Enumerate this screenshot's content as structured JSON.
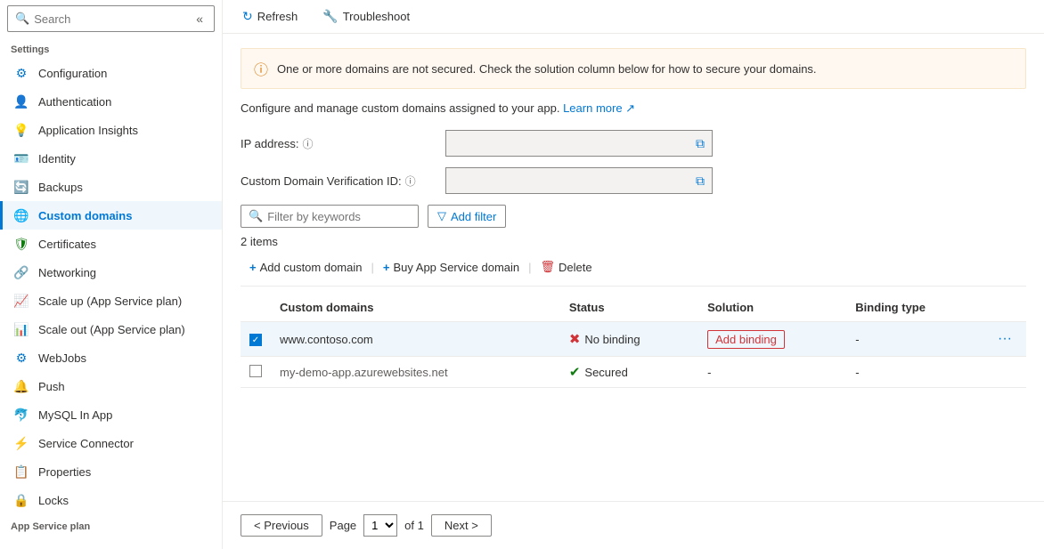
{
  "sidebar": {
    "search_placeholder": "Search",
    "collapse_icon": "«",
    "sections": [
      {
        "label": "Settings",
        "items": [
          {
            "id": "configuration",
            "label": "Configuration",
            "icon": "⚙",
            "icon_color": "#0078d4",
            "active": false
          },
          {
            "id": "authentication",
            "label": "Authentication",
            "icon": "👤",
            "icon_color": "#6264a7",
            "active": false
          },
          {
            "id": "application-insights",
            "label": "Application Insights",
            "icon": "💡",
            "icon_color": "#8b5cf6",
            "active": false
          },
          {
            "id": "identity",
            "label": "Identity",
            "icon": "🪪",
            "icon_color": "#f59e0b",
            "active": false
          },
          {
            "id": "backups",
            "label": "Backups",
            "icon": "🔄",
            "icon_color": "#0078d4",
            "active": false
          },
          {
            "id": "custom-domains",
            "label": "Custom domains",
            "icon": "🌐",
            "icon_color": "#0078d4",
            "active": true
          },
          {
            "id": "certificates",
            "label": "Certificates",
            "icon": "🛡",
            "icon_color": "#107c10",
            "active": false
          },
          {
            "id": "networking",
            "label": "Networking",
            "icon": "🔗",
            "icon_color": "#0078d4",
            "active": false
          },
          {
            "id": "scale-up",
            "label": "Scale up (App Service plan)",
            "icon": "📈",
            "icon_color": "#0078d4",
            "active": false
          },
          {
            "id": "scale-out",
            "label": "Scale out (App Service plan)",
            "icon": "📊",
            "icon_color": "#0078d4",
            "active": false
          },
          {
            "id": "webjobs",
            "label": "WebJobs",
            "icon": "⚙",
            "icon_color": "#0078d4",
            "active": false
          },
          {
            "id": "push",
            "label": "Push",
            "icon": "🔔",
            "icon_color": "#0078d4",
            "active": false
          },
          {
            "id": "mysql-in-app",
            "label": "MySQL In App",
            "icon": "🐬",
            "icon_color": "#0078d4",
            "active": false
          },
          {
            "id": "service-connector",
            "label": "Service Connector",
            "icon": "⚡",
            "icon_color": "#0078d4",
            "active": false
          },
          {
            "id": "properties",
            "label": "Properties",
            "icon": "📋",
            "icon_color": "#0078d4",
            "active": false
          },
          {
            "id": "locks",
            "label": "Locks",
            "icon": "🔒",
            "icon_color": "#605e5c",
            "active": false
          }
        ]
      }
    ],
    "bottom_section_label": "App Service plan"
  },
  "toolbar": {
    "refresh_label": "Refresh",
    "troubleshoot_label": "Troubleshoot",
    "refresh_icon": "↻",
    "troubleshoot_icon": "🔧"
  },
  "main": {
    "warning_text": "One or more domains are not secured. Check the solution column below for how to secure your domains.",
    "description": "Configure and manage custom domains assigned to your app.",
    "learn_more_label": "Learn more",
    "ip_address_label": "IP address:",
    "custom_domain_id_label": "Custom Domain Verification ID:",
    "info_icon": "ⓘ",
    "filter_placeholder": "Filter by keywords",
    "add_filter_label": "Add filter",
    "items_count": "2 items",
    "actions": {
      "add_custom_domain": "Add custom domain",
      "buy_app_service_domain": "Buy App Service domain",
      "delete": "Delete"
    },
    "table": {
      "columns": [
        "Custom domains",
        "Status",
        "Solution",
        "Binding type"
      ],
      "rows": [
        {
          "id": "row1",
          "selected": true,
          "domain": "www.contoso.com",
          "status": "No binding",
          "status_type": "error",
          "solution": "Add binding",
          "solution_type": "action",
          "binding_type": "-"
        },
        {
          "id": "row2",
          "selected": false,
          "domain": "my-demo-app.azurewebsites.net",
          "domain_muted": true,
          "status": "Secured",
          "status_type": "success",
          "solution": "-",
          "solution_type": "text",
          "binding_type": "-"
        }
      ]
    }
  },
  "pagination": {
    "previous_label": "< Previous",
    "next_label": "Next >",
    "page_label": "Page",
    "of_label": "of 1",
    "current_page": "1",
    "page_options": [
      "1"
    ]
  }
}
